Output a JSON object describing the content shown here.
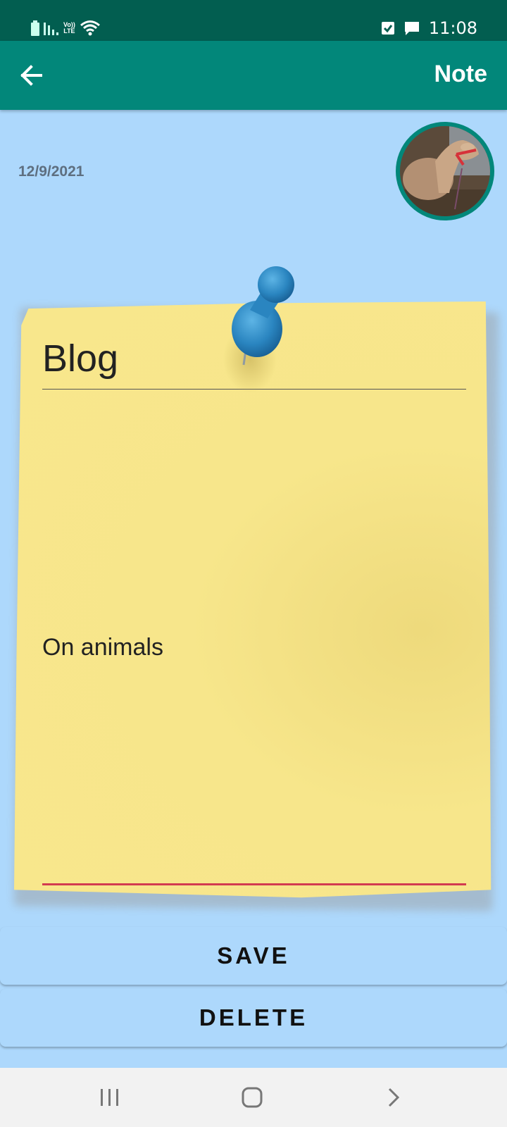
{
  "status_bar": {
    "time": "11:08",
    "lte_top": "Vo))",
    "lte_bottom": "LTE",
    "icons": [
      "battery-icon",
      "signal-icon",
      "wifi-icon",
      "checkbox-notification-icon",
      "message-notification-icon"
    ]
  },
  "app_bar": {
    "title": "Note",
    "back_icon": "arrow-left-icon",
    "background": "#02877A"
  },
  "note": {
    "date": "12/9/2021",
    "title": "Blog",
    "body": "On animals",
    "paper_color": "#F8E78C",
    "pin_color": "#2A85C0"
  },
  "avatar": {
    "icon": "animal-photo-avatar",
    "border_color": "#02877A"
  },
  "buttons": {
    "save_label": "SAVE",
    "delete_label": "DELETE"
  },
  "nav_bar": {
    "recents_icon": "recents-icon",
    "home_icon": "home-icon",
    "back_icon": "chevron-right-icon"
  }
}
